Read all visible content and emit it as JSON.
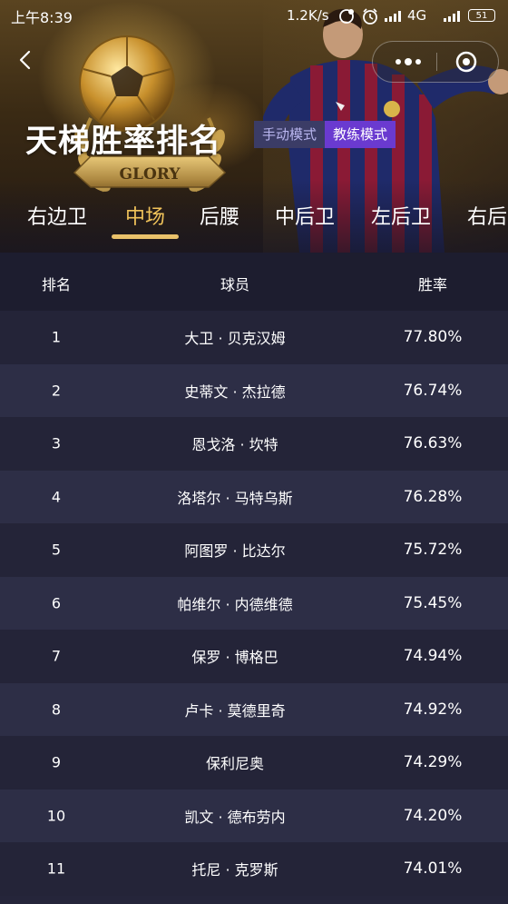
{
  "status_bar": {
    "time": "上午8:39",
    "speed": "1.2K/s",
    "network": "4G",
    "battery": "51"
  },
  "header": {
    "title": "天梯胜率排名",
    "modes": [
      "手动模式",
      "教练模式"
    ],
    "active_mode_index": 1,
    "trophy_text": "GLORY"
  },
  "tabs": [
    "右边卫",
    "中场",
    "后腰",
    "中后卫",
    "左后卫",
    "右后"
  ],
  "active_tab_index": 1,
  "table": {
    "columns": [
      "排名",
      "球员",
      "胜率"
    ],
    "rows": [
      {
        "rank": "1",
        "player": "大卫 · 贝克汉姆",
        "rate": "77.80%"
      },
      {
        "rank": "2",
        "player": "史蒂文 · 杰拉德",
        "rate": "76.74%"
      },
      {
        "rank": "3",
        "player": "恩戈洛 · 坎特",
        "rate": "76.63%"
      },
      {
        "rank": "4",
        "player": "洛塔尔 · 马特乌斯",
        "rate": "76.28%"
      },
      {
        "rank": "5",
        "player": "阿图罗 · 比达尔",
        "rate": "75.72%"
      },
      {
        "rank": "6",
        "player": "帕维尔 · 内德维德",
        "rate": "75.45%"
      },
      {
        "rank": "7",
        "player": "保罗 · 博格巴",
        "rate": "74.94%"
      },
      {
        "rank": "8",
        "player": "卢卡 · 莫德里奇",
        "rate": "74.92%"
      },
      {
        "rank": "9",
        "player": "保利尼奥",
        "rate": "74.29%"
      },
      {
        "rank": "10",
        "player": "凯文 · 德布劳内",
        "rate": "74.20%"
      },
      {
        "rank": "11",
        "player": "托尼 · 克罗斯",
        "rate": "74.01%"
      }
    ]
  },
  "colors": {
    "accent_gold": "#f0c35a",
    "mode_active": "#6a3ad0",
    "mode_inactive": "#3b3c66",
    "row_odd": "#242438",
    "row_even": "#2d2e46",
    "header_bg": "#1d1d2f"
  },
  "icons": [
    "back-icon",
    "more-icon",
    "close-target-icon",
    "wifi-icon",
    "alarm-icon",
    "signal-icon",
    "battery-icon"
  ]
}
